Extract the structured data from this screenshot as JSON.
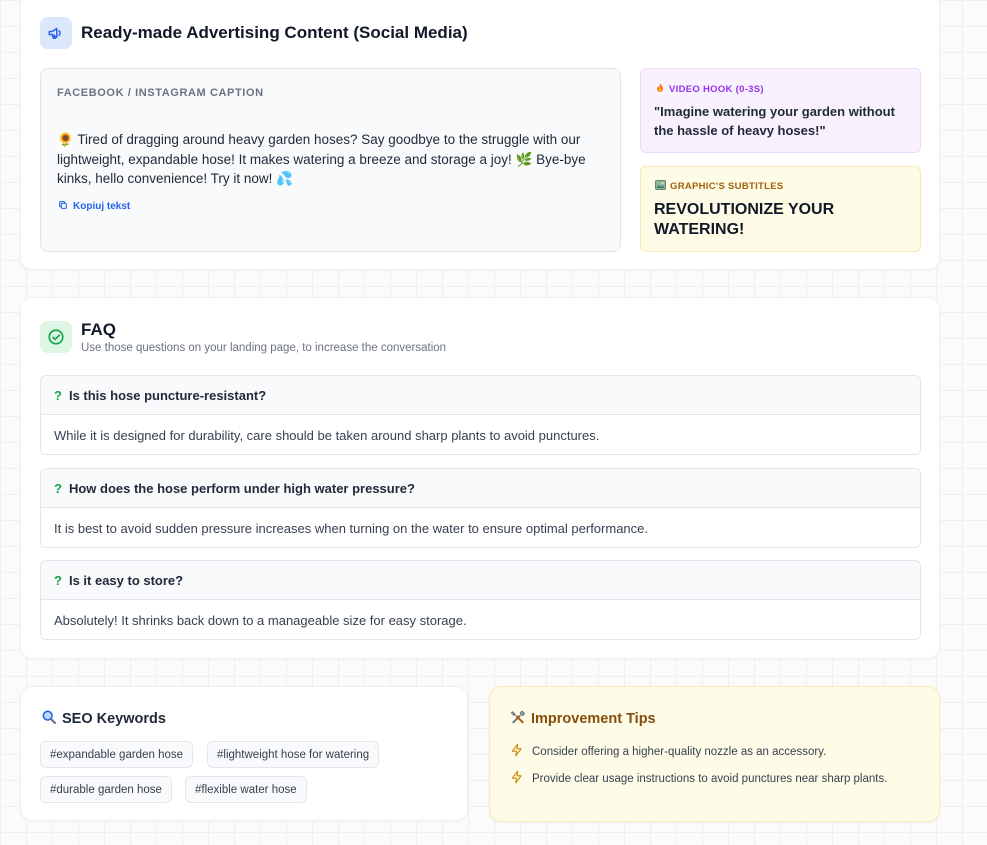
{
  "ads": {
    "title": "Ready-made Advertising Content (Social Media)",
    "caption_label": "FACEBOOK / INSTAGRAM CAPTION",
    "caption_text": "🌻 Tired of dragging around heavy garden hoses? Say goodbye to the struggle with our lightweight, expandable hose! It makes watering a breeze and storage a joy! 🌿 Bye-bye kinks, hello convenience! Try it now! 💦",
    "copy_label": "Kopiuj tekst",
    "hook_label": "VIDEO HOOK (0-3S)",
    "hook_text": "\"Imagine watering your garden without the hassle of heavy hoses!\"",
    "subs_label": "GRAPHIC'S SUBTITLES",
    "subs_text": "REVOLUTIONIZE YOUR WATERING!"
  },
  "faq": {
    "title": "FAQ",
    "subtitle": "Use those questions on your landing page, to increase the conversation",
    "items": [
      {
        "q": "Is this hose puncture-resistant?",
        "a": "While it is designed for durability, care should be taken around sharp plants to avoid punctures."
      },
      {
        "q": "How does the hose perform under high water pressure?",
        "a": "It is best to avoid sudden pressure increases when turning on the water to ensure optimal performance."
      },
      {
        "q": "Is it easy to store?",
        "a": "Absolutely! It shrinks back down to a manageable size for easy storage."
      }
    ]
  },
  "seo": {
    "title": "SEO Keywords",
    "tags": [
      "#expandable garden hose",
      "#lightweight hose for watering",
      "#durable garden hose",
      "#flexible water hose"
    ]
  },
  "tips": {
    "title": "Improvement Tips",
    "items": [
      "Consider offering a higher-quality nozzle as an accessory.",
      "Provide clear usage instructions to avoid punctures near sharp plants."
    ]
  },
  "icons": {
    "ads": "megaphone-icon",
    "faq": "check-circle-icon",
    "seo": "magnifier-icon",
    "tips": "tools-icon",
    "tip_bullet": "lightning-icon",
    "copy": "copy-icon",
    "hook": "fire-icon",
    "subs": "picture-icon"
  },
  "colors": {
    "accent_blue": "#2563eb",
    "faq_green": "#16a34a",
    "hook_purple": "#9333ea",
    "subs_amber": "#a16207",
    "tips_brown": "#854d0e"
  }
}
